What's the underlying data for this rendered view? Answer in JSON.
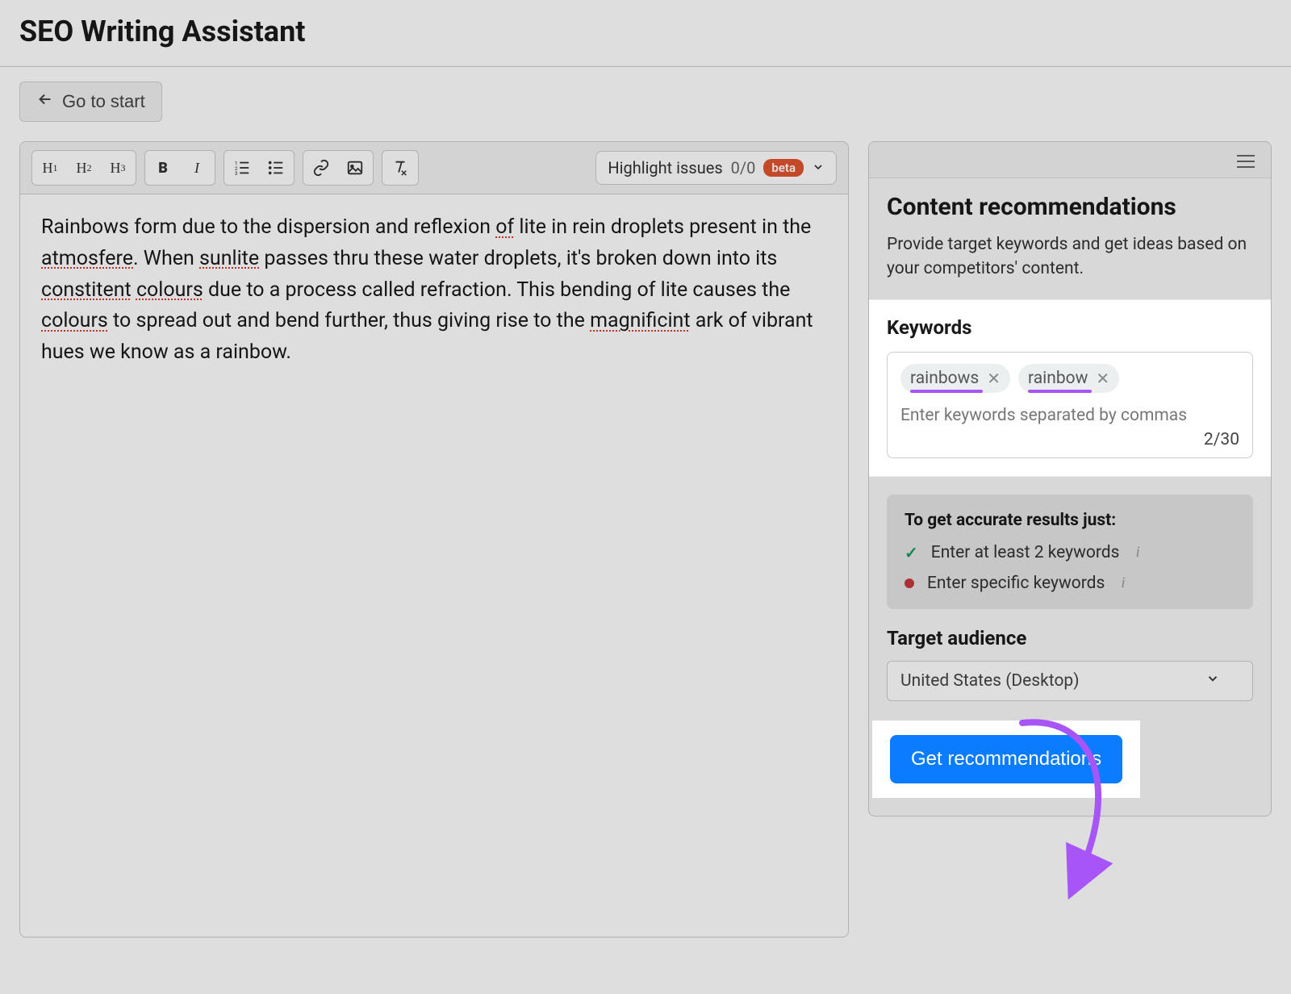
{
  "page_title": "SEO Writing Assistant",
  "back_button": "Go to start",
  "toolbar": {
    "highlight_label": "Highlight issues",
    "highlight_count": "0/0",
    "beta_label": "beta"
  },
  "editor": {
    "text_parts": [
      {
        "t": "Rainbows form due to the dispersion and reflexion "
      },
      {
        "t": "of",
        "err": true
      },
      {
        "t": " lite in rein droplets present in the "
      },
      {
        "t": "atmosfere",
        "err": true
      },
      {
        "t": ". When "
      },
      {
        "t": "sunlite",
        "err": true
      },
      {
        "t": " passes thru these water droplets, it's broken down into its "
      },
      {
        "t": "constitent",
        "err": true
      },
      {
        "t": " "
      },
      {
        "t": "colours",
        "err": true
      },
      {
        "t": " due to a process called refraction. This bending of lite causes the "
      },
      {
        "t": "colours",
        "err": true
      },
      {
        "t": " to spread out and bend further, thus giving rise to the "
      },
      {
        "t": "magnificint",
        "err": true
      },
      {
        "t": " ark of vibrant hues we know as a rainbow."
      }
    ]
  },
  "sidebar": {
    "title": "Content recommendations",
    "description": "Provide target keywords and get ideas based on your competitors' content.",
    "keywords_label": "Keywords",
    "keyword_chips": [
      "rainbows",
      "rainbow"
    ],
    "keyword_placeholder": "Enter keywords separated by commas",
    "keyword_counter": "2/30",
    "tips_title": "To get accurate results just:",
    "tips": [
      {
        "status": "done",
        "text": "Enter at least 2 keywords"
      },
      {
        "status": "pending",
        "text": "Enter specific keywords"
      }
    ],
    "target_label": "Target audience",
    "target_value": "United States (Desktop)",
    "cta_label": "Get recommendations"
  }
}
